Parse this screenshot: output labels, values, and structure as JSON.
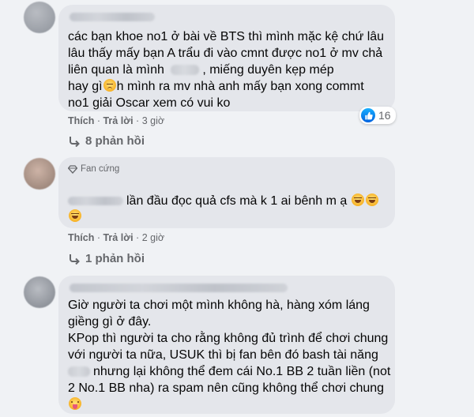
{
  "comments": [
    {
      "lines": [
        "các bạn khoe no1 ở bài về BTS thì mình mặc kệ chứ lâu",
        "lâu thấy mấy bạn A trẩu đi vào cmnt được no1 ở mv chả",
        "liên quan là mình",
        ",  miếng duyên kẹp mép",
        "hay gì",
        "h mình ra mv nhà anh mấy bạn xong commt",
        "no1 giải Oscar xem có vui ko"
      ],
      "like_label": "Thích",
      "reply_label": "Trả lời",
      "time": "3 giờ",
      "reaction_count": "16",
      "replies_label": "8 phản hồi",
      "emoji_icon": "disappointed-face-icon"
    },
    {
      "badge": "Fan cứng",
      "text": "lần đầu đọc quả cfs mà k 1 ai bênh m ạ",
      "like_label": "Thích",
      "reply_label": "Trả lời",
      "time": "2 giờ",
      "replies_label": "1 phản hồi",
      "emoji_icon": "rolling-on-floor-laughing-icon"
    },
    {
      "lines": [
        "Giờ người ta chơi một mình không hà, hàng xóm láng",
        "giềng gì ở đây.",
        "KPop thì người ta cho rằng không đủ trình để chơi chung",
        "với người ta nữa, USUK thì bị fan bên đó bash tài năng",
        "nhưng lại không thể đem cái No.1 BB 2 tuần liền (not",
        "2 No.1 BB nha) ra spam nên cũng không thể chơi chung"
      ],
      "emoji_icon": "tongue-face-icon"
    }
  ],
  "separator": "·",
  "colors": {
    "background": "#f0f2f5",
    "bubble": "#e4e6eb",
    "meta": "#65676b",
    "like_blue": "#0866ff"
  }
}
